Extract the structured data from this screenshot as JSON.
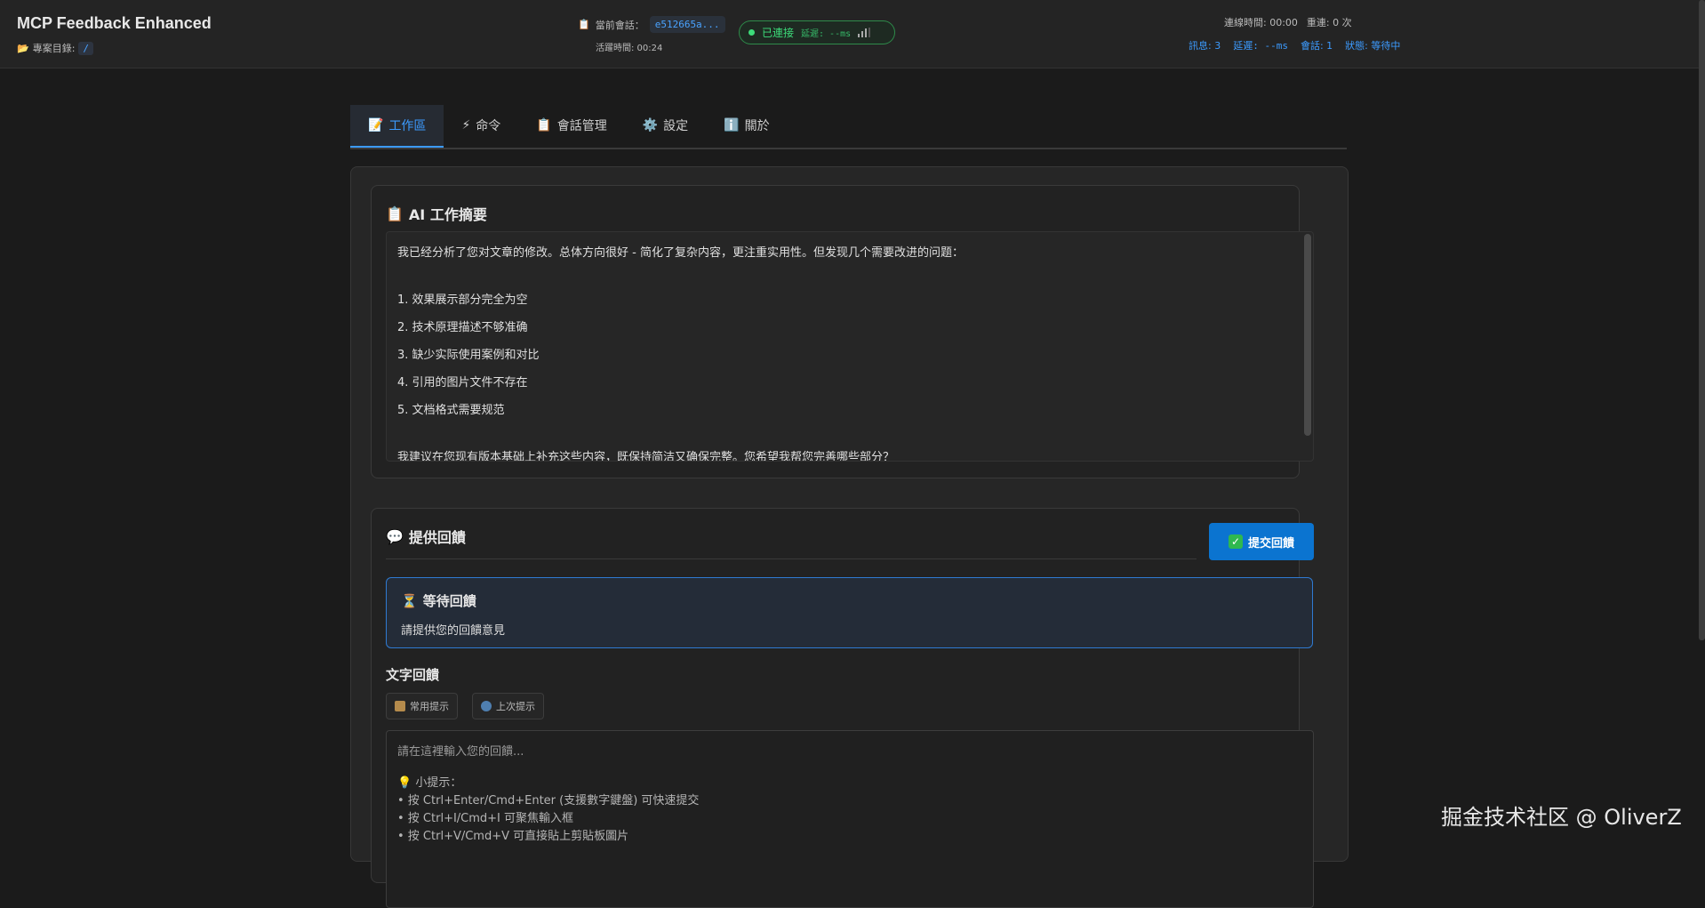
{
  "header": {
    "title": "MCP Feedback Enhanced",
    "project_label": "專案目錄:",
    "project_path": "/",
    "session_label": "當前會話：",
    "session_id": "e512665a...",
    "active_time": "活躍時間: 00:24",
    "connection_status": "已連接",
    "connection_latency": "延遲: --ms",
    "connection_color": "#3ddc7a",
    "stats_top": {
      "conn_time": "連線時間: 00:00",
      "reconnect": "重連: 0 次"
    },
    "stats_bottom": {
      "messages": "訊息: 3",
      "latency": "延遲: --ms",
      "sessions": "會話: 1",
      "status": "狀態: 等待中"
    }
  },
  "tabs": [
    {
      "icon": "📝",
      "label": "工作區",
      "active": true
    },
    {
      "icon": "⚡",
      "label": "命令",
      "active": false
    },
    {
      "icon": "📋",
      "label": "會話管理",
      "active": false
    },
    {
      "icon": "⚙️",
      "label": "設定",
      "active": false
    },
    {
      "icon": "ℹ️",
      "label": "關於",
      "active": false
    }
  ],
  "summary": {
    "icon": "📋",
    "title": "AI 工作摘要",
    "intro": "我已经分析了您对文章的修改。总体方向很好 - 简化了复杂内容，更注重实用性。但发现几个需要改进的问题：",
    "items": [
      "1. 效果展示部分完全为空",
      "2. 技术原理描述不够准确",
      "3. 缺少实际使用案例和对比",
      "4. 引用的图片文件不存在",
      "5. 文档格式需要规范"
    ],
    "closing": "我建议在您现有版本基础上补充这些内容，既保持简洁又确保完整。您希望我帮您完善哪些部分？"
  },
  "feedback": {
    "icon": "💬",
    "title": "提供回饋",
    "submit_label": "提交回饋",
    "waiting_icon": "⏳",
    "waiting_title": "等待回饋",
    "waiting_message": "請提供您的回饋意見",
    "text_label": "文字回饋",
    "chip_common": "常用提示",
    "chip_last": "上次提示",
    "placeholder": "請在這裡輸入您的回饋...",
    "tip_title": "💡 小提示：",
    "tips": [
      "• 按 Ctrl+Enter/Cmd+Enter (支援數字鍵盤) 可快速提交",
      "• 按 Ctrl+I/Cmd+I 可聚焦輸入框",
      "• 按 Ctrl+V/Cmd+V 可直接貼上剪貼板圖片"
    ]
  },
  "watermark": "掘金技术社区 @ OliverZ"
}
